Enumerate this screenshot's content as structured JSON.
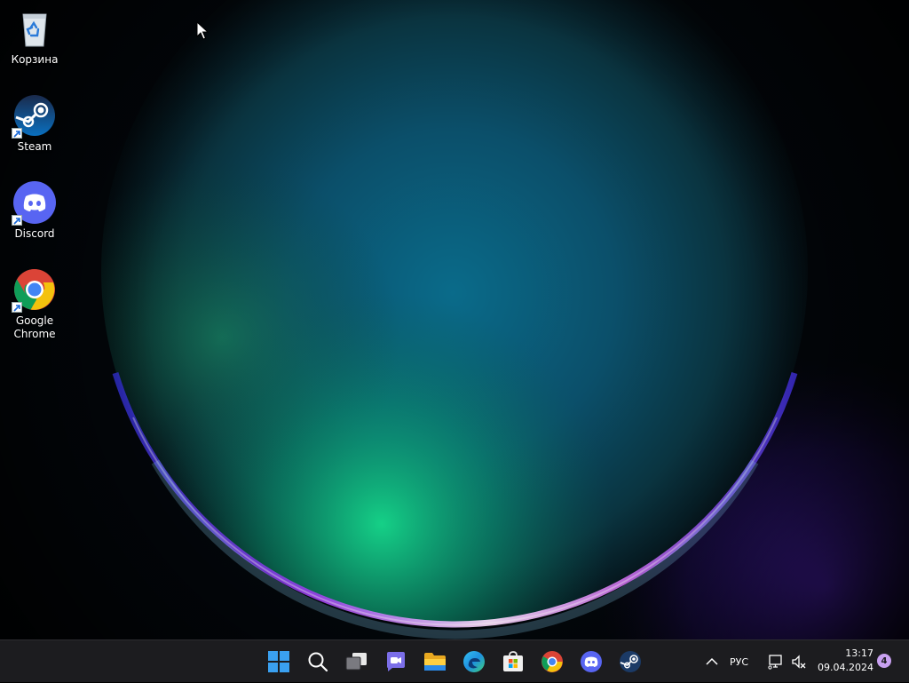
{
  "desktop": {
    "icons": [
      {
        "label": "Корзина",
        "icon": "recycle-bin-icon"
      },
      {
        "label": "Steam",
        "icon": "steam-icon"
      },
      {
        "label": "Discord",
        "icon": "discord-icon"
      },
      {
        "label": "Google Chrome",
        "icon": "chrome-icon"
      }
    ]
  },
  "taskbar": {
    "apps": [
      {
        "name": "Start",
        "icon": "windows-start-icon"
      },
      {
        "name": "Search",
        "icon": "search-icon"
      },
      {
        "name": "Task View",
        "icon": "task-view-icon"
      },
      {
        "name": "Chat",
        "icon": "teams-chat-icon"
      },
      {
        "name": "File Explorer",
        "icon": "file-explorer-icon"
      },
      {
        "name": "Microsoft Edge",
        "icon": "edge-icon"
      },
      {
        "name": "Microsoft Store",
        "icon": "store-icon"
      },
      {
        "name": "Google Chrome",
        "icon": "chrome-icon"
      },
      {
        "name": "Discord",
        "icon": "discord-icon"
      },
      {
        "name": "Steam",
        "icon": "steam-icon"
      }
    ],
    "tray": {
      "language": "РУС",
      "time": "13:17",
      "date": "09.04.2024",
      "notifications": "4"
    }
  },
  "colors": {
    "taskbar_bg": "#1c1c1f",
    "accent": "#0078d4",
    "discord": "#5865f2",
    "notification_badge": "#c8a0f0"
  }
}
